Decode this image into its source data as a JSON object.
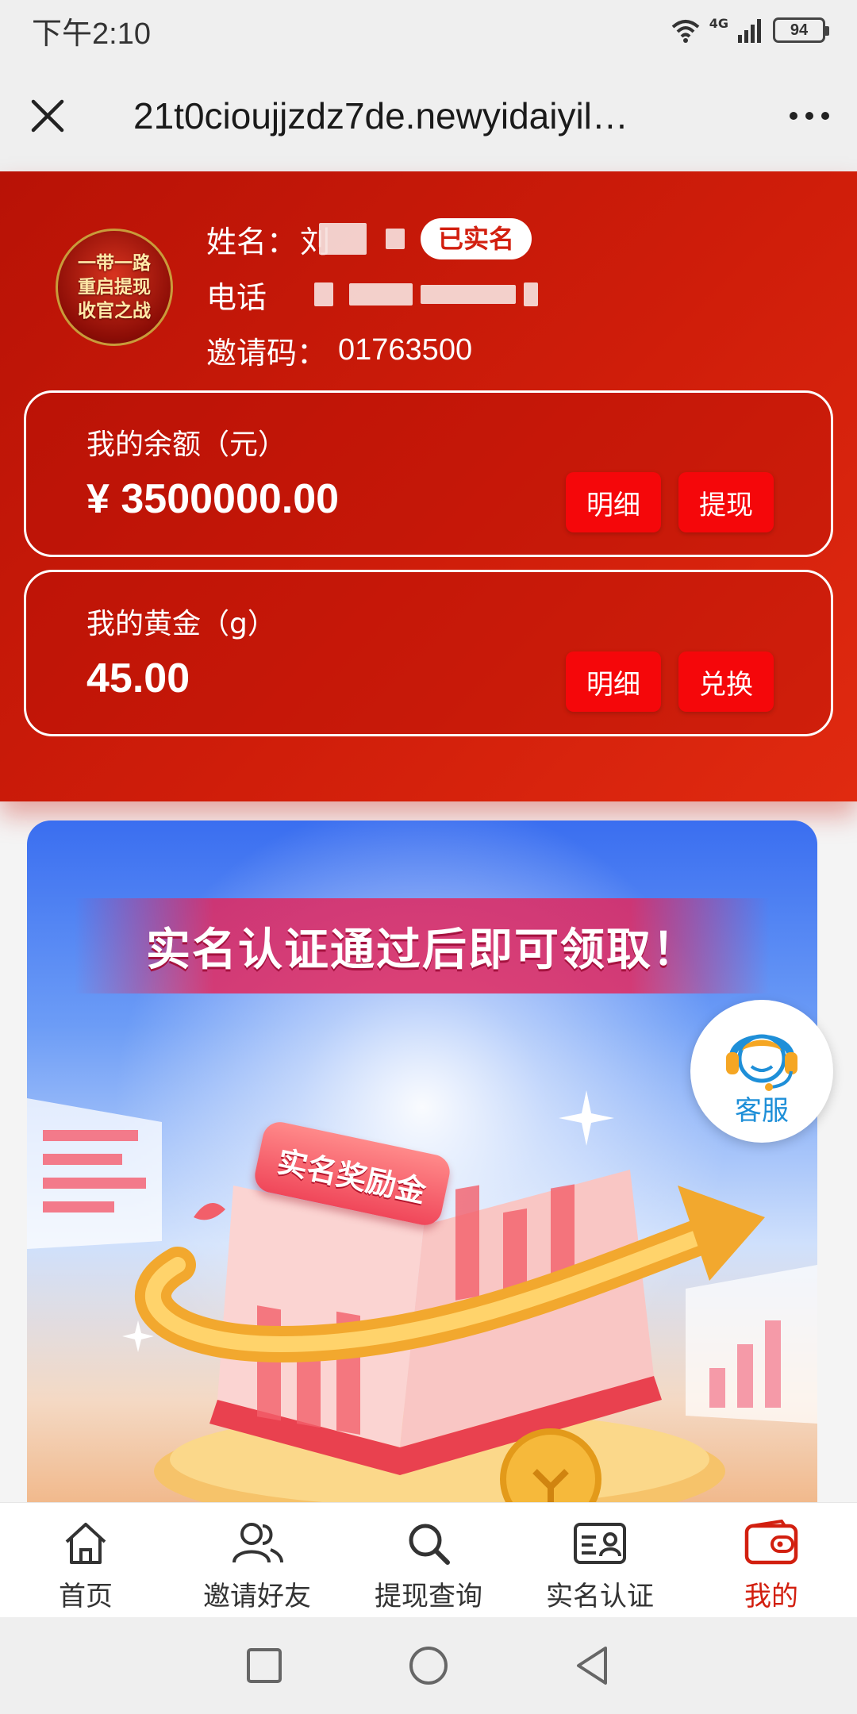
{
  "status_bar": {
    "time": "下午2:10",
    "network": "4G",
    "battery": "94"
  },
  "title_bar": {
    "url": "21t0cioujjzdz7de.newyidaiyil…"
  },
  "profile": {
    "avatar_lines": [
      "一带一路",
      "重启提现",
      "收官之战"
    ],
    "name_label": "姓名：",
    "name_value": "刘",
    "verified_badge": "已实名",
    "phone_label": "电话",
    "invite_label": "邀请码：",
    "invite_code": "01763500"
  },
  "balance_card": {
    "title": "我的余额（元）",
    "value": "¥ 3500000.00",
    "detail_btn": "明细",
    "withdraw_btn": "提现"
  },
  "gold_card": {
    "title": "我的黄金（g）",
    "value": "45.00",
    "detail_btn": "明细",
    "exchange_btn": "兑换"
  },
  "banner": {
    "title": "实名认证通过后即可领取！",
    "tag": "实名奖励金"
  },
  "customer_service": {
    "label": "客服"
  },
  "bottom_nav": [
    {
      "label": "首页",
      "icon": "home-icon"
    },
    {
      "label": "邀请好友",
      "icon": "users-icon"
    },
    {
      "label": "提现查询",
      "icon": "search-icon"
    },
    {
      "label": "实名认证",
      "icon": "id-card-icon"
    },
    {
      "label": "我的",
      "icon": "wallet-icon"
    }
  ],
  "colors": {
    "brand_red": "#d21f0f",
    "button_red": "#f5070a",
    "cs_blue": "#1e8fd8"
  }
}
